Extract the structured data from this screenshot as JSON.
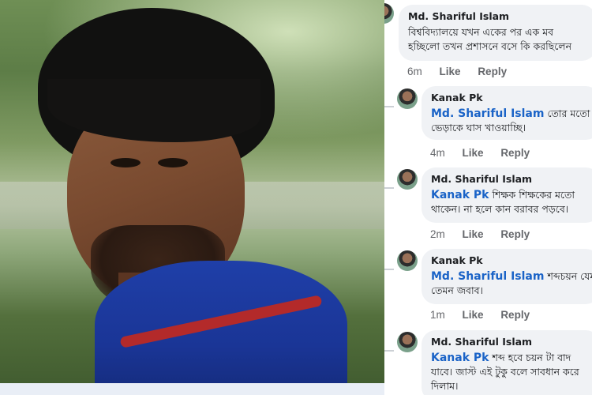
{
  "comments": [
    {
      "author": "Md. Shariful Islam",
      "mention": "",
      "lines": [
        "বিশ্ববিদ্যালয়ে যখন একের পর এক মব",
        "হচ্ছিলো তখন প্রশাসনে বসে কি করছিলেন"
      ],
      "time": "6m",
      "like": "Like",
      "reply": "Reply"
    },
    {
      "author": "Kanak Pk",
      "mention": "Md. Shariful Islam",
      "lines": [
        "তোর মতো",
        "ভেড়াকে ঘাস খাওয়াচ্ছি।"
      ],
      "time": "4m",
      "like": "Like",
      "reply": "Reply"
    },
    {
      "author": "Md. Shariful Islam",
      "mention": "Kanak Pk",
      "lines": [
        "শিক্ষক শিক্ষকের মতো",
        "থাকেন। না হলে কান বরাবর পড়বে।"
      ],
      "time": "2m",
      "like": "Like",
      "reply": "Reply"
    },
    {
      "author": "Kanak Pk",
      "mention": "Md. Shariful Islam",
      "lines": [
        "শব্দচয়ন যেমন",
        "তেমন জবাব।"
      ],
      "time": "1m",
      "like": "Like",
      "reply": "Reply"
    },
    {
      "author": "Md. Shariful Islam",
      "mention": "Kanak Pk",
      "lines": [
        "শব্দ হবে চয়ন টা বাদ",
        "যাবে। জাস্ট এই টুকু বলে সাবধান করে",
        "দিলাম।"
      ]
    }
  ]
}
